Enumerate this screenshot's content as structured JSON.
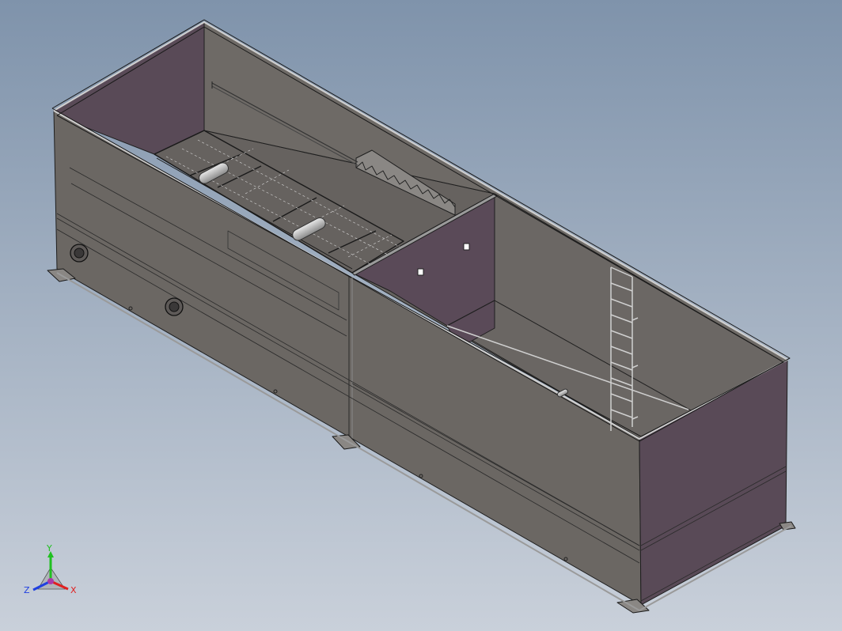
{
  "viewport": {
    "background_top": "#7f93ab",
    "background_bottom": "#c9d0da",
    "model_name": ""
  },
  "model": {
    "outer_wall_color": "#6b6763",
    "inner_wall_color": "#5a4a58",
    "floor_color": "#6a6664",
    "edge_color": "#1f1f1f",
    "rim_color": "#b8b8b8"
  },
  "triad": {
    "x_label": "X",
    "y_label": "Y",
    "z_label": "Z",
    "x_color": "#e02020",
    "y_color": "#20c020",
    "z_color": "#2040e0"
  }
}
